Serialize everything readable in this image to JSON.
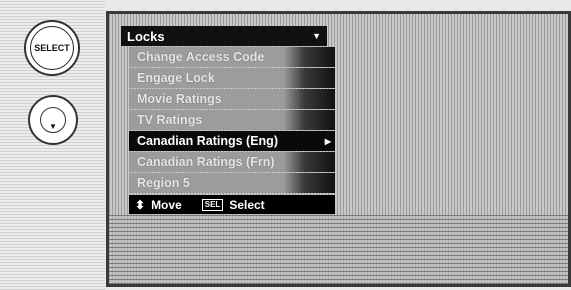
{
  "remote": {
    "select_button_label": "SELECT"
  },
  "menu": {
    "title": "Locks",
    "items": [
      {
        "label": "Change Access Code"
      },
      {
        "label": "Engage Lock"
      },
      {
        "label": "Movie Ratings"
      },
      {
        "label": "TV Ratings"
      },
      {
        "label": "Canadian Ratings (Eng)",
        "selected": true
      },
      {
        "label": "Canadian Ratings (Frn)"
      },
      {
        "label": "Region 5"
      }
    ],
    "footer": {
      "move_label": "Move",
      "sel_key": "SEL",
      "select_label": "Select"
    }
  }
}
